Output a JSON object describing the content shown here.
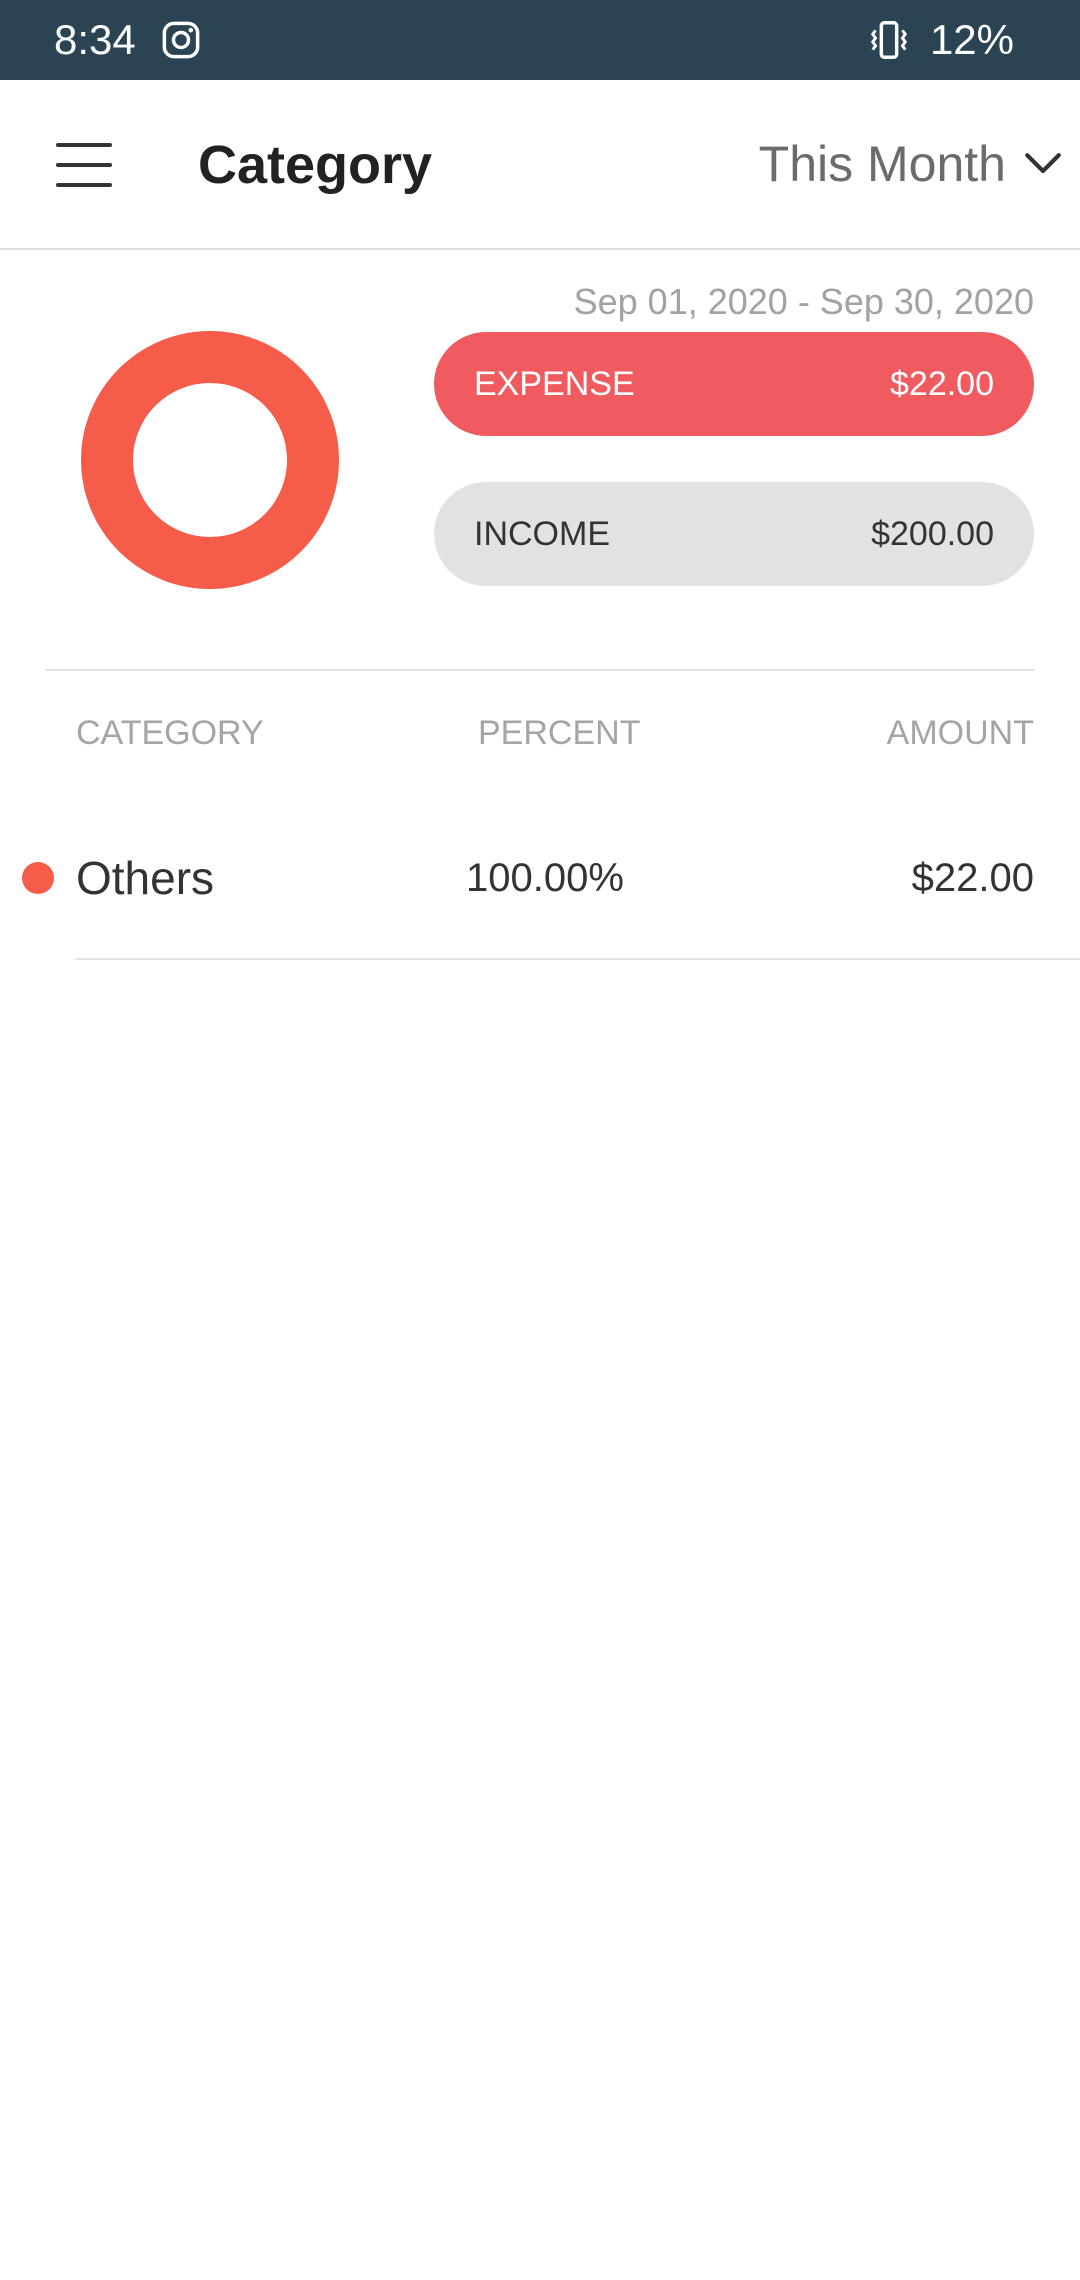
{
  "status_bar": {
    "time": "8:34",
    "battery": "12%",
    "icons": [
      "instagram-icon",
      "vibrate-icon"
    ]
  },
  "app_bar": {
    "title": "Category",
    "period": "This Month",
    "icons": [
      "menu-icon",
      "chevron-down-icon"
    ]
  },
  "summary": {
    "date_range": "Sep 01, 2020 - Sep 30, 2020",
    "expense": {
      "label": "EXPENSE",
      "amount": "$22.00",
      "color": "#ef5b5f"
    },
    "income": {
      "label": "INCOME",
      "amount": "$200.00",
      "color": "#e2e2e2"
    }
  },
  "table": {
    "headers": {
      "category": "CATEGORY",
      "percent": "PERCENT",
      "amount": "AMOUNT"
    },
    "rows": [
      {
        "category": "Others",
        "percent": "100.00%",
        "amount": "$22.00",
        "color": "#f55c4a"
      }
    ]
  },
  "chart_data": {
    "type": "pie",
    "categories": [
      "Others"
    ],
    "values": [
      100.0
    ],
    "colors": [
      "#f55c4a"
    ]
  }
}
